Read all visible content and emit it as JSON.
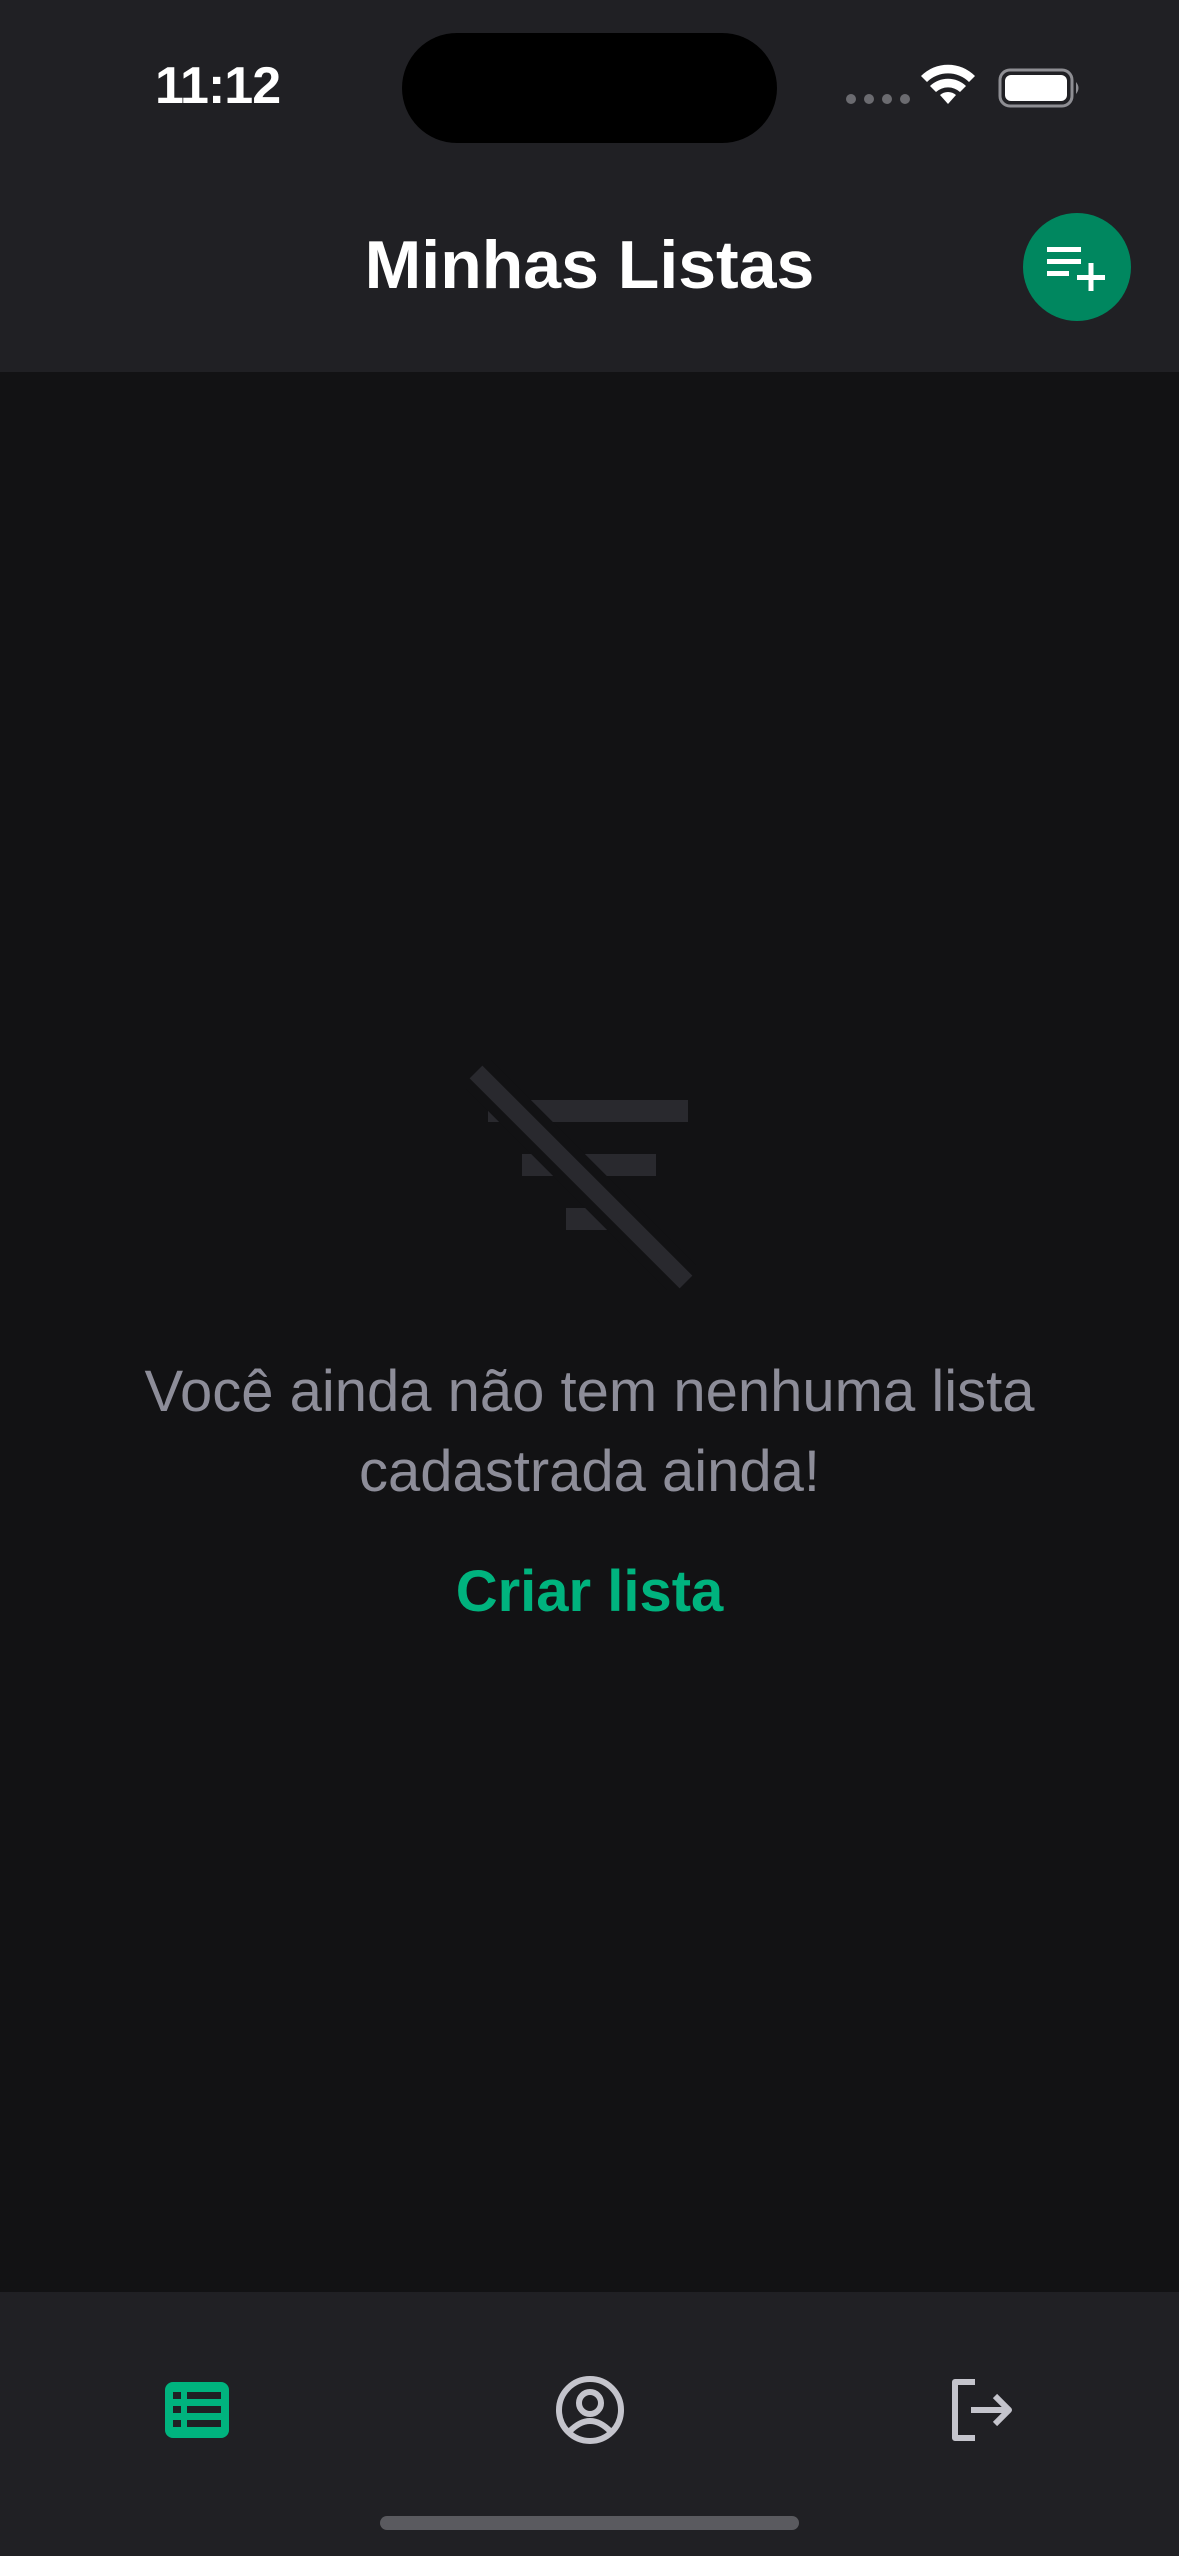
{
  "status": {
    "time": "11:12"
  },
  "header": {
    "title": "Minhas Listas",
    "add_icon": "playlist-add-icon"
  },
  "empty_state": {
    "icon": "filter-off-icon",
    "message": "Você ainda não tem nenhuma lista cadastrada ainda!",
    "action_label": "Criar lista"
  },
  "tabs": [
    {
      "icon": "list-icon",
      "active": true
    },
    {
      "icon": "user-circle-icon",
      "active": false
    },
    {
      "icon": "sign-out-icon",
      "active": false
    }
  ],
  "colors": {
    "accent": "#00b37e",
    "accent_dark": "#00875f",
    "background": "#121214",
    "surface": "#202024",
    "muted_text": "#8d8d99",
    "icon_inactive": "#c4c4cc"
  }
}
